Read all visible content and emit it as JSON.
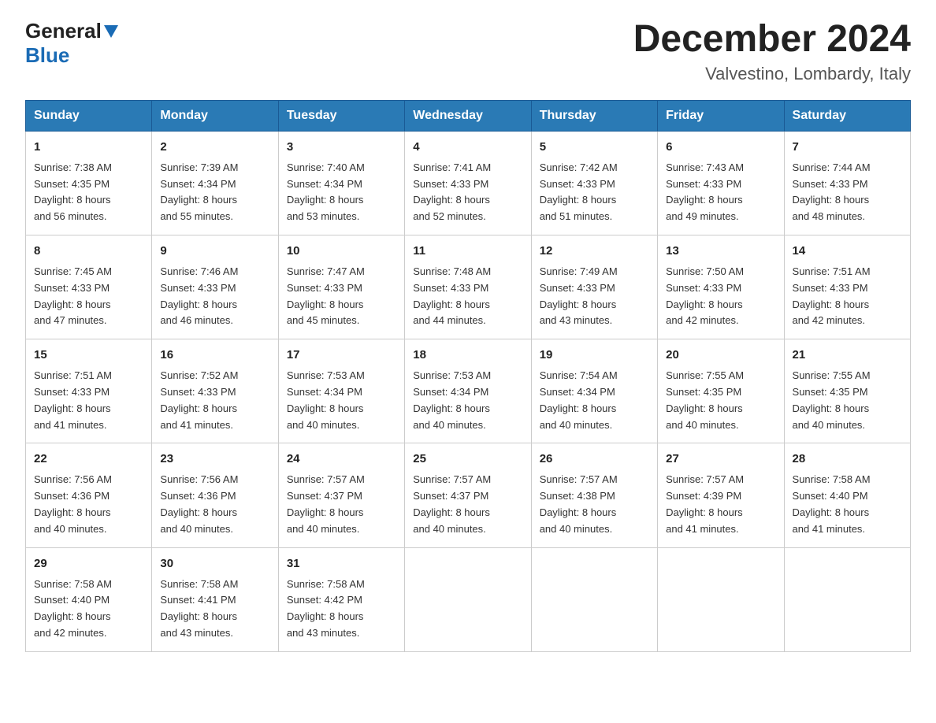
{
  "header": {
    "logo": {
      "general": "General",
      "blue": "Blue"
    },
    "month": "December 2024",
    "location": "Valvestino, Lombardy, Italy"
  },
  "days_of_week": [
    "Sunday",
    "Monday",
    "Tuesday",
    "Wednesday",
    "Thursday",
    "Friday",
    "Saturday"
  ],
  "weeks": [
    [
      {
        "day": 1,
        "sunrise": "7:38 AM",
        "sunset": "4:35 PM",
        "daylight": "8 hours and 56 minutes."
      },
      {
        "day": 2,
        "sunrise": "7:39 AM",
        "sunset": "4:34 PM",
        "daylight": "8 hours and 55 minutes."
      },
      {
        "day": 3,
        "sunrise": "7:40 AM",
        "sunset": "4:34 PM",
        "daylight": "8 hours and 53 minutes."
      },
      {
        "day": 4,
        "sunrise": "7:41 AM",
        "sunset": "4:33 PM",
        "daylight": "8 hours and 52 minutes."
      },
      {
        "day": 5,
        "sunrise": "7:42 AM",
        "sunset": "4:33 PM",
        "daylight": "8 hours and 51 minutes."
      },
      {
        "day": 6,
        "sunrise": "7:43 AM",
        "sunset": "4:33 PM",
        "daylight": "8 hours and 49 minutes."
      },
      {
        "day": 7,
        "sunrise": "7:44 AM",
        "sunset": "4:33 PM",
        "daylight": "8 hours and 48 minutes."
      }
    ],
    [
      {
        "day": 8,
        "sunrise": "7:45 AM",
        "sunset": "4:33 PM",
        "daylight": "8 hours and 47 minutes."
      },
      {
        "day": 9,
        "sunrise": "7:46 AM",
        "sunset": "4:33 PM",
        "daylight": "8 hours and 46 minutes."
      },
      {
        "day": 10,
        "sunrise": "7:47 AM",
        "sunset": "4:33 PM",
        "daylight": "8 hours and 45 minutes."
      },
      {
        "day": 11,
        "sunrise": "7:48 AM",
        "sunset": "4:33 PM",
        "daylight": "8 hours and 44 minutes."
      },
      {
        "day": 12,
        "sunrise": "7:49 AM",
        "sunset": "4:33 PM",
        "daylight": "8 hours and 43 minutes."
      },
      {
        "day": 13,
        "sunrise": "7:50 AM",
        "sunset": "4:33 PM",
        "daylight": "8 hours and 42 minutes."
      },
      {
        "day": 14,
        "sunrise": "7:51 AM",
        "sunset": "4:33 PM",
        "daylight": "8 hours and 42 minutes."
      }
    ],
    [
      {
        "day": 15,
        "sunrise": "7:51 AM",
        "sunset": "4:33 PM",
        "daylight": "8 hours and 41 minutes."
      },
      {
        "day": 16,
        "sunrise": "7:52 AM",
        "sunset": "4:33 PM",
        "daylight": "8 hours and 41 minutes."
      },
      {
        "day": 17,
        "sunrise": "7:53 AM",
        "sunset": "4:34 PM",
        "daylight": "8 hours and 40 minutes."
      },
      {
        "day": 18,
        "sunrise": "7:53 AM",
        "sunset": "4:34 PM",
        "daylight": "8 hours and 40 minutes."
      },
      {
        "day": 19,
        "sunrise": "7:54 AM",
        "sunset": "4:34 PM",
        "daylight": "8 hours and 40 minutes."
      },
      {
        "day": 20,
        "sunrise": "7:55 AM",
        "sunset": "4:35 PM",
        "daylight": "8 hours and 40 minutes."
      },
      {
        "day": 21,
        "sunrise": "7:55 AM",
        "sunset": "4:35 PM",
        "daylight": "8 hours and 40 minutes."
      }
    ],
    [
      {
        "day": 22,
        "sunrise": "7:56 AM",
        "sunset": "4:36 PM",
        "daylight": "8 hours and 40 minutes."
      },
      {
        "day": 23,
        "sunrise": "7:56 AM",
        "sunset": "4:36 PM",
        "daylight": "8 hours and 40 minutes."
      },
      {
        "day": 24,
        "sunrise": "7:57 AM",
        "sunset": "4:37 PM",
        "daylight": "8 hours and 40 minutes."
      },
      {
        "day": 25,
        "sunrise": "7:57 AM",
        "sunset": "4:37 PM",
        "daylight": "8 hours and 40 minutes."
      },
      {
        "day": 26,
        "sunrise": "7:57 AM",
        "sunset": "4:38 PM",
        "daylight": "8 hours and 40 minutes."
      },
      {
        "day": 27,
        "sunrise": "7:57 AM",
        "sunset": "4:39 PM",
        "daylight": "8 hours and 41 minutes."
      },
      {
        "day": 28,
        "sunrise": "7:58 AM",
        "sunset": "4:40 PM",
        "daylight": "8 hours and 41 minutes."
      }
    ],
    [
      {
        "day": 29,
        "sunrise": "7:58 AM",
        "sunset": "4:40 PM",
        "daylight": "8 hours and 42 minutes."
      },
      {
        "day": 30,
        "sunrise": "7:58 AM",
        "sunset": "4:41 PM",
        "daylight": "8 hours and 43 minutes."
      },
      {
        "day": 31,
        "sunrise": "7:58 AM",
        "sunset": "4:42 PM",
        "daylight": "8 hours and 43 minutes."
      },
      null,
      null,
      null,
      null
    ]
  ],
  "labels": {
    "sunrise": "Sunrise:",
    "sunset": "Sunset:",
    "daylight": "Daylight:"
  }
}
